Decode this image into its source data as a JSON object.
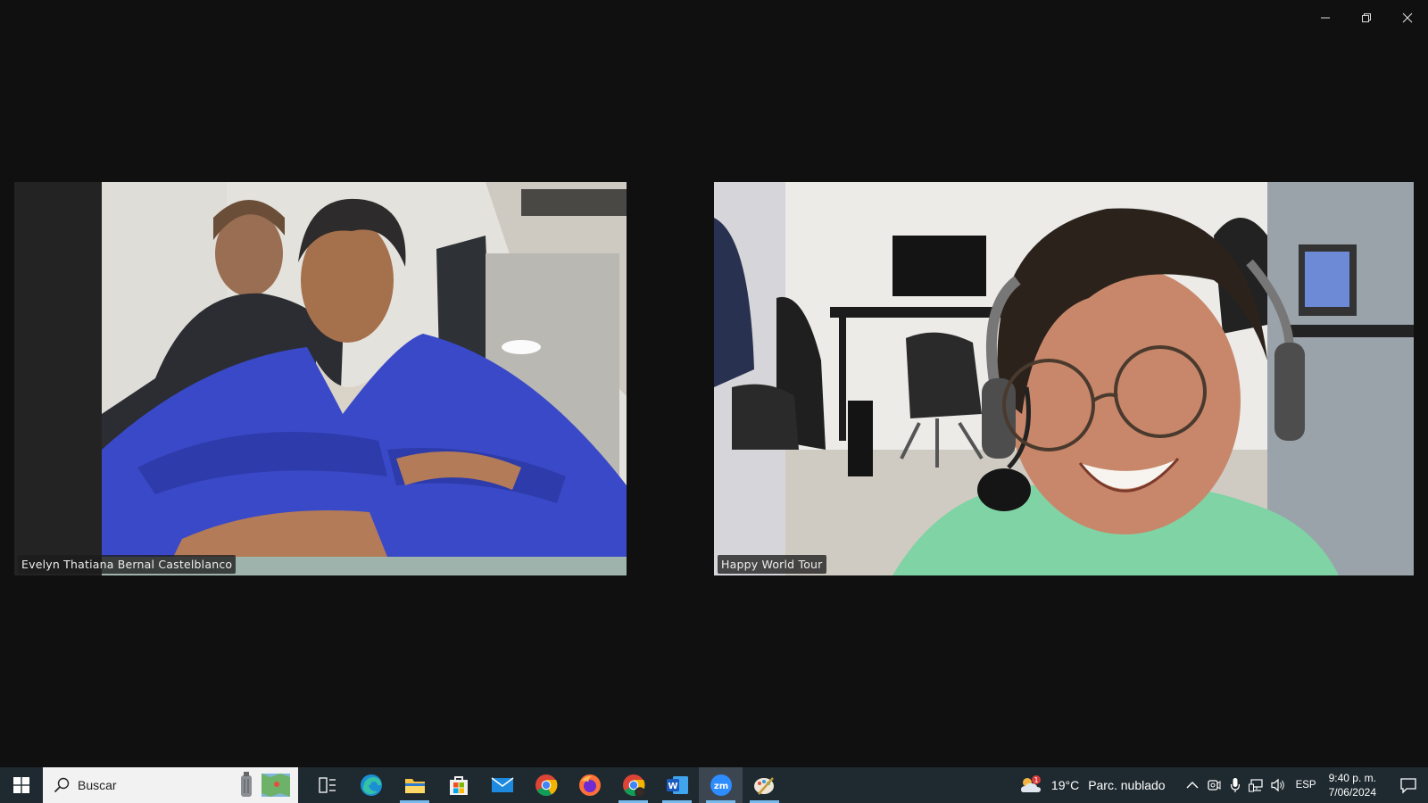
{
  "window": {
    "controls": {
      "minimize": "minimize",
      "restore": "restore",
      "close": "close"
    }
  },
  "participants": [
    {
      "name": "Evelyn Thatiana Bernal Castelblanco"
    },
    {
      "name": "Happy World Tour"
    }
  ],
  "taskbar": {
    "search_placeholder": "Buscar",
    "apps": [
      {
        "name": "task-view",
        "icon": "task-view-icon"
      },
      {
        "name": "edge",
        "icon": "edge-icon"
      },
      {
        "name": "file-explorer",
        "icon": "folder-icon",
        "active": true
      },
      {
        "name": "microsoft-store",
        "icon": "store-icon"
      },
      {
        "name": "mail",
        "icon": "mail-icon"
      },
      {
        "name": "chrome",
        "icon": "chrome-icon"
      },
      {
        "name": "firefox",
        "icon": "firefox-icon"
      },
      {
        "name": "chrome-profile",
        "icon": "chrome-profile-icon",
        "active": true
      },
      {
        "name": "word",
        "icon": "word-icon",
        "active": true
      },
      {
        "name": "zoom",
        "icon": "zoom-icon",
        "active": true,
        "focused": true
      },
      {
        "name": "paint",
        "icon": "paint-icon",
        "active": true
      }
    ],
    "weather": {
      "temp": "19°C",
      "condition": "Parc. nublado",
      "badge": "1"
    },
    "language": "ESP",
    "time": "9:40 p. m.",
    "date": "7/06/2024"
  },
  "colors": {
    "background": "#101010",
    "taskbar": "#1f2a30",
    "accent": "#76b9ed"
  }
}
